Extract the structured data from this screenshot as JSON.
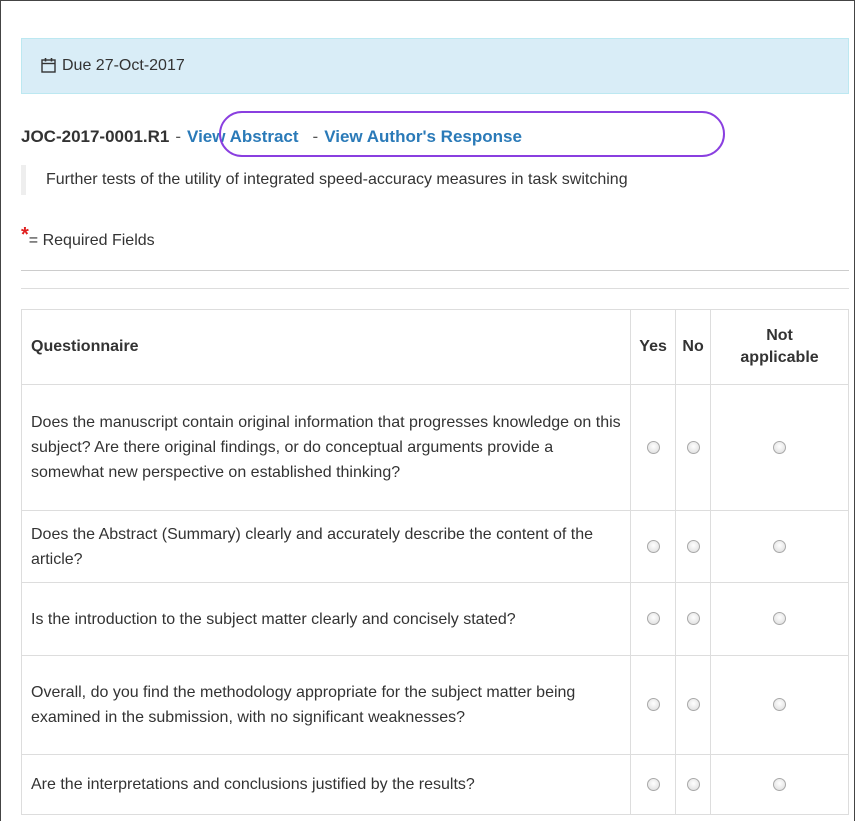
{
  "due_banner": {
    "icon": "calendar-icon",
    "text": "Due 27-Oct-2017"
  },
  "manuscript": {
    "id": "JOC-2017-0001.R1",
    "separator_1": "-",
    "view_abstract_label": "View Abstract",
    "separator_2": "-",
    "view_response_label": "View Author's Response",
    "title": "Further tests of the utility of integrated speed-accuracy measures in task switching"
  },
  "required_note": {
    "star": "*",
    "text": "= Required Fields"
  },
  "questionnaire": {
    "headers": {
      "question": "Questionnaire",
      "yes": "Yes",
      "no": "No",
      "na_line1": "Not",
      "na_line2": "applicable"
    },
    "rows": [
      {
        "question": "Does the manuscript contain original information that progresses knowledge on this subject? Are there original findings, or do conceptual arguments provide a somewhat new perspective on established thinking?"
      },
      {
        "question": "Does the Abstract (Summary) clearly and accurately describe the content of the article?"
      },
      {
        "question": "Is the introduction to the subject matter clearly and concisely stated?"
      },
      {
        "question": "Overall, do you find the methodology appropriate for the subject matter being examined in the submission, with no significant weaknesses?"
      },
      {
        "question": "Are the interpretations and conclusions justified by the results?"
      }
    ]
  },
  "colors": {
    "banner_bg": "#d9edf7",
    "link": "#2a7ab8",
    "highlight_oval": "#8a3fe0",
    "required_star": "#e02020"
  }
}
